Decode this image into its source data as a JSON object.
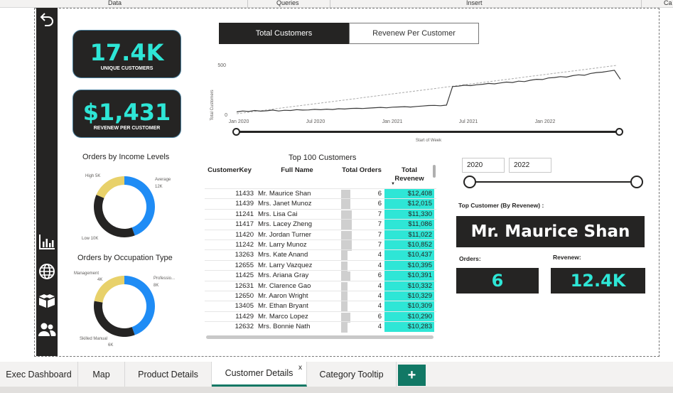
{
  "ribbon": {
    "data_label": "Data",
    "queries_label": "Queries",
    "insert_label": "Insert",
    "ca_label": "Ca"
  },
  "kpi": {
    "unique_customers_value": "17.4K",
    "unique_customers_label": "UNIQUE CUSTOMERS",
    "revenue_per_customer_value": "$1,431",
    "revenue_per_customer_label": "REVENEW PER CUSTOMER"
  },
  "toggle": {
    "total_customers": "Total Customers",
    "revenue_per_customer": "Revenew Per Customer"
  },
  "line_chart": {
    "ylabel": "Total Customers",
    "xlabel": "Start of Week",
    "ytick_top": "500",
    "ytick_bottom": "0",
    "xticks": [
      "Jan 2020",
      "Jul 2020",
      "Jan 2021",
      "Jul 2021",
      "Jan 2022"
    ]
  },
  "chart_data": {
    "type": "line",
    "ylabel": "Total Customers",
    "xlabel": "Start of Week",
    "ylim": [
      0,
      550
    ],
    "x": [
      0,
      2,
      4,
      6,
      8,
      10,
      12,
      14,
      16,
      18,
      20,
      22,
      24,
      26,
      28,
      30,
      32,
      34,
      36,
      38,
      40,
      42,
      44,
      46,
      48,
      50,
      52,
      54,
      56,
      58,
      60,
      62,
      64,
      66,
      68,
      70,
      72,
      74,
      76,
      78,
      80,
      82,
      84,
      86,
      88,
      90,
      92,
      94,
      96,
      98,
      100,
      102,
      104,
      106,
      108,
      110,
      112,
      114,
      116,
      118,
      120,
      122,
      124,
      126,
      128
    ],
    "y": [
      20,
      30,
      25,
      35,
      28,
      32,
      40,
      30,
      38,
      35,
      45,
      40,
      42,
      48,
      44,
      50,
      46,
      55,
      52,
      58,
      60,
      57,
      62,
      66,
      70,
      65,
      72,
      75,
      78,
      74,
      80,
      85,
      90,
      92,
      88,
      95,
      300,
      305,
      315,
      310,
      320,
      325,
      335,
      330,
      340,
      350,
      345,
      360,
      355,
      370,
      380,
      378,
      395,
      400,
      410,
      405,
      420,
      430,
      425,
      445,
      455,
      460,
      470,
      480,
      380
    ]
  },
  "donut_income": {
    "title": "Orders by Income Levels",
    "labels": [
      "High 5K",
      "Average",
      "12K",
      "Low 10K"
    ],
    "slices": [
      {
        "name": "Average",
        "value": 12,
        "color": "#1f8cf5"
      },
      {
        "name": "Low",
        "value": 10,
        "color": "#252423"
      },
      {
        "name": "High",
        "value": 5,
        "color": "#e8d16a"
      }
    ]
  },
  "donut_occupation": {
    "title": "Orders by Occupation Type",
    "labels": [
      "Management",
      "4K",
      "Professio...",
      "8K",
      "Skilled Manual",
      "6K"
    ],
    "slices": [
      {
        "name": "Professional",
        "value": 8,
        "color": "#1f8cf5"
      },
      {
        "name": "Skilled Manual",
        "value": 6,
        "color": "#252423"
      },
      {
        "name": "Management",
        "value": 4,
        "color": "#e8d16a"
      }
    ]
  },
  "table": {
    "title": "Top 100 Customers",
    "headers": [
      "CustomerKey",
      "Full Name",
      "Total Orders",
      "Total",
      "Revenew"
    ],
    "rows": [
      {
        "key": "11433",
        "name": "Mr. Maurice Shan",
        "orders": "6",
        "revenue": "$12,408"
      },
      {
        "key": "11439",
        "name": "Mrs. Janet Munoz",
        "orders": "6",
        "revenue": "$12,015"
      },
      {
        "key": "11241",
        "name": "Mrs. Lisa Cai",
        "orders": "7",
        "revenue": "$11,330"
      },
      {
        "key": "11417",
        "name": "Mrs. Lacey Zheng",
        "orders": "7",
        "revenue": "$11,086"
      },
      {
        "key": "11420",
        "name": "Mr. Jordan Turner",
        "orders": "7",
        "revenue": "$11,022"
      },
      {
        "key": "11242",
        "name": "Mr. Larry Munoz",
        "orders": "7",
        "revenue": "$10,852"
      },
      {
        "key": "13263",
        "name": "Mrs. Kate Anand",
        "orders": "4",
        "revenue": "$10,437"
      },
      {
        "key": "12655",
        "name": "Mr. Larry Vazquez",
        "orders": "4",
        "revenue": "$10,395"
      },
      {
        "key": "11425",
        "name": "Mrs. Ariana Gray",
        "orders": "6",
        "revenue": "$10,391"
      },
      {
        "key": "12631",
        "name": "Mr. Clarence Gao",
        "orders": "4",
        "revenue": "$10,332"
      },
      {
        "key": "12650",
        "name": "Mr. Aaron Wright",
        "orders": "4",
        "revenue": "$10,329"
      },
      {
        "key": "13405",
        "name": "Mr. Ethan Bryant",
        "orders": "4",
        "revenue": "$10,309"
      },
      {
        "key": "11429",
        "name": "Mr. Marco Lopez",
        "orders": "6",
        "revenue": "$10,290"
      },
      {
        "key": "12632",
        "name": "Mrs. Bonnie Nath",
        "orders": "4",
        "revenue": "$10,283"
      }
    ]
  },
  "year_filter": {
    "from": "2020",
    "to": "2022"
  },
  "top_customer": {
    "label": "Top Customer (By Revenew) :",
    "name": "Mr. Maurice Shan",
    "orders_label": "Orders:",
    "orders_value": "6",
    "revenue_label": "Revenew:",
    "revenue_value": "12.4K"
  },
  "tabs": [
    {
      "label": "Exec Dashboard"
    },
    {
      "label": "Map"
    },
    {
      "label": "Product Details"
    },
    {
      "label": "Customer Details"
    },
    {
      "label": "Category Tooltip"
    }
  ],
  "tab_close": "x",
  "add_page": "+",
  "colors": {
    "accent": "#2ee6d6",
    "dark": "#252423",
    "blue": "#1f8cf5",
    "yellow": "#e8d16a",
    "tab_green": "#117865"
  }
}
